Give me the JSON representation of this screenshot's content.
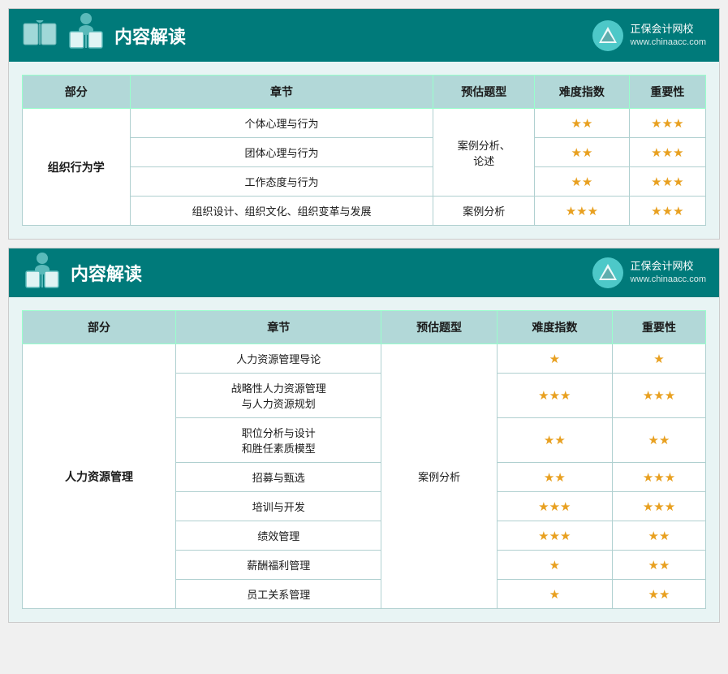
{
  "panel1": {
    "title": "内容解读",
    "logo_name": "正保会计网校",
    "logo_url": "www.chinaacc.com",
    "table": {
      "headers": [
        "部分",
        "章节",
        "预估题型",
        "难度指数",
        "重要性"
      ],
      "rows": [
        {
          "part": "组织行为学",
          "chapter": "个体心理与行为",
          "type": "案例分析、论述",
          "difficulty": "★★",
          "importance": "★★★",
          "rowspan_part": 4,
          "rowspan_type": 3
        },
        {
          "part": "",
          "chapter": "团体心理与行为",
          "type": "",
          "difficulty": "★★",
          "importance": "★★★"
        },
        {
          "part": "",
          "chapter": "工作态度与行为",
          "type": "",
          "difficulty": "★★",
          "importance": "★★★"
        },
        {
          "part": "",
          "chapter": "组织设计、组织文化、组织变革与发展",
          "type": "案例分析",
          "difficulty": "★★★",
          "importance": "★★★"
        }
      ]
    }
  },
  "panel2": {
    "title": "内容解读",
    "logo_name": "正保会计网校",
    "logo_url": "www.chinaacc.com",
    "table": {
      "headers": [
        "部分",
        "章节",
        "预估题型",
        "难度指数",
        "重要性"
      ],
      "rows": [
        {
          "part": "人力资源管理",
          "chapter": "人力资源管理导论",
          "type": "案例分析",
          "difficulty": "★",
          "importance": "★"
        },
        {
          "part": "",
          "chapter": "战略性人力资源管理与人力资源规划",
          "type": "",
          "difficulty": "★★★",
          "importance": "★★★"
        },
        {
          "part": "",
          "chapter": "职位分析与设计和胜任素质模型",
          "type": "",
          "difficulty": "★★",
          "importance": "★★"
        },
        {
          "part": "",
          "chapter": "招募与甄选",
          "type": "",
          "difficulty": "★★",
          "importance": "★★★"
        },
        {
          "part": "",
          "chapter": "培训与开发",
          "type": "",
          "difficulty": "★★★",
          "importance": "★★★"
        },
        {
          "part": "",
          "chapter": "绩效管理",
          "type": "",
          "difficulty": "★★★",
          "importance": "★★"
        },
        {
          "part": "",
          "chapter": "薪酬福利管理",
          "type": "",
          "difficulty": "★",
          "importance": "★★"
        },
        {
          "part": "",
          "chapter": "员工关系管理",
          "type": "",
          "difficulty": "★",
          "importance": "★★"
        }
      ]
    }
  }
}
